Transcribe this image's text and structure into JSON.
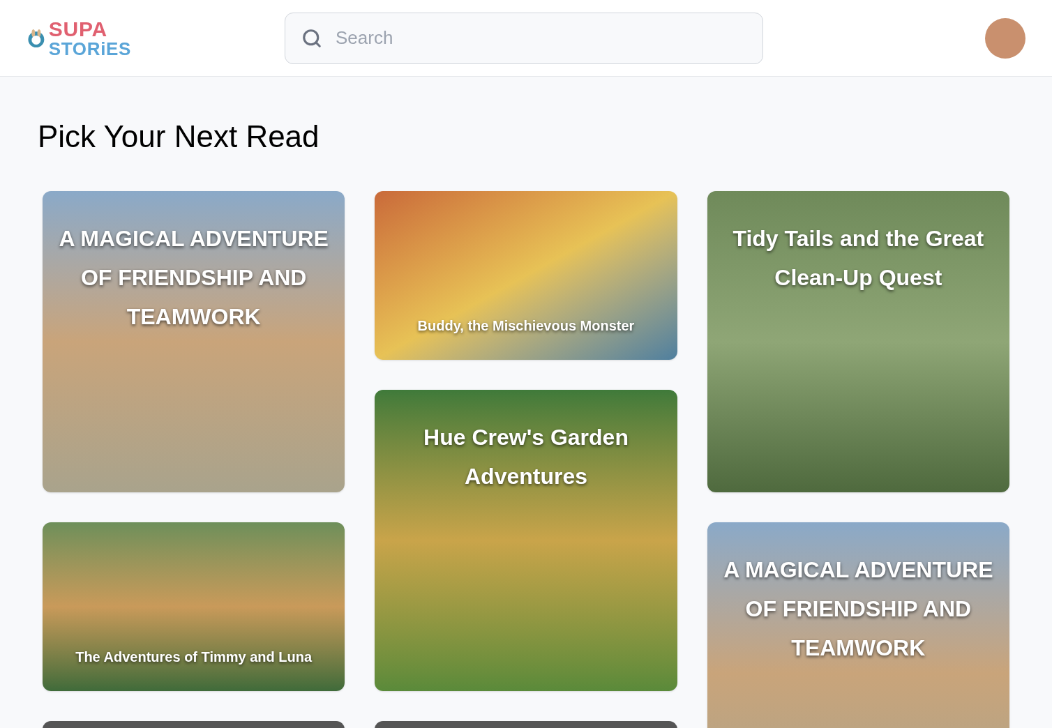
{
  "header": {
    "logo": {
      "line_1": "SUPA",
      "line_2": "STORiES"
    },
    "search": {
      "placeholder": "Search"
    }
  },
  "heading": "Pick Your Next Read",
  "columns": [
    {
      "cards": [
        {
          "title": "A MAGICAL ADVENTURE OF FRIENDSHIP AND TEAMWORK",
          "kind": "tall"
        },
        {
          "title": "The Adventures of Timmy and Luna",
          "kind": "short"
        },
        {
          "kind": "cut"
        }
      ]
    },
    {
      "cards": [
        {
          "title": "Buddy, the Mischievous Monster",
          "kind": "short"
        },
        {
          "title": "Hue Crew's Garden Adventures",
          "kind": "tall"
        },
        {
          "kind": "cut"
        }
      ]
    },
    {
      "cards": [
        {
          "title": "Tidy Tails and the Great Clean-Up Quest",
          "kind": "tall"
        },
        {
          "title": "A MAGICAL ADVENTURE OF FRIENDSHIP AND TEAMWORK",
          "kind": "tall"
        }
      ]
    }
  ]
}
